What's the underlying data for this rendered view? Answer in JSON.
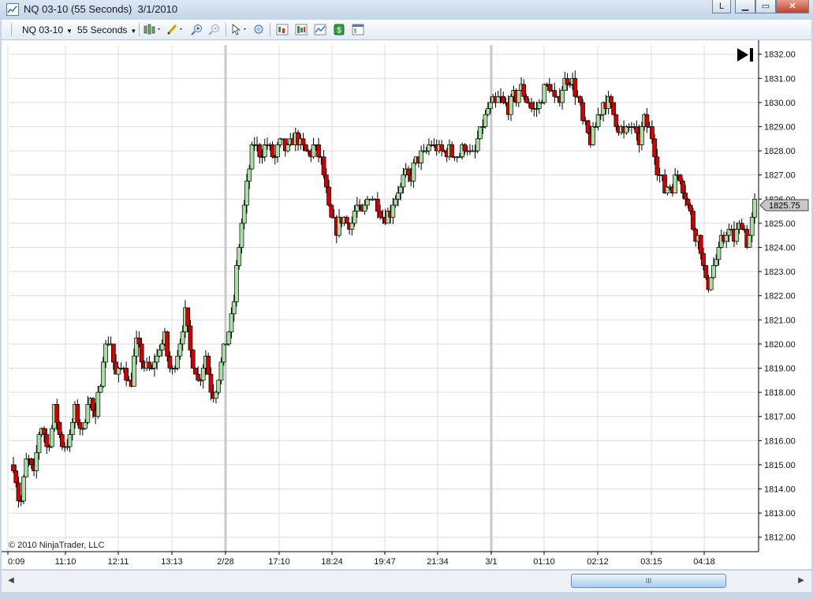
{
  "window": {
    "title": "NQ 03-10 (55 Seconds)  3/1/2010",
    "link_button": "L",
    "minimize_label": "▁",
    "maximize_label": "▭",
    "close_label": "✕"
  },
  "toolbar": {
    "instrument": "NQ 03-10",
    "interval": "55 Seconds",
    "icons": [
      "bar-style-icon",
      "drawing-tool-icon",
      "zoom-in-icon",
      "zoom-out-icon",
      "pointer-icon",
      "magnifier-icon",
      "data-series-icon",
      "strategies-icon",
      "indicators-icon",
      "order-entry-icon",
      "properties-icon"
    ]
  },
  "colors": {
    "up_candle": "#a8e0a4",
    "down_candle": "#d40000",
    "wick": "#000000",
    "grid": "#dcdcdc",
    "session_break": "#c8c8c8"
  },
  "copyright": "© 2010 NinjaTrader, LLC",
  "scroll": {
    "thumb_label": "III"
  },
  "chart_data": {
    "type": "candlestick",
    "symbol": "NQ 03-10",
    "interval": "55 Seconds",
    "ylim": [
      1812,
      1832.5
    ],
    "yticks": [
      "1812.00",
      "1813.00",
      "1814.00",
      "1815.00",
      "1816.00",
      "1817.00",
      "1818.00",
      "1819.00",
      "1820.00",
      "1821.00",
      "1822.00",
      "1823.00",
      "1824.00",
      "1825.00",
      "1826.00",
      "1827.00",
      "1828.00",
      "1829.00",
      "1830.00",
      "1831.00",
      "1832.00"
    ],
    "xticks": [
      "0:09",
      "11:10",
      "12:11",
      "13:13",
      "2/28",
      "17:10",
      "18:24",
      "19:47",
      "21:34",
      "3/1",
      "01:10",
      "02:12",
      "03:15",
      "04:18"
    ],
    "session_breaks": [
      "2/28",
      "3/1"
    ],
    "last_price": "1825.75",
    "path": [
      1815,
      1813.2,
      1815.4,
      1814.6,
      1816.8,
      1815.5,
      1817.2,
      1816.0,
      1815.8,
      1817.4,
      1816.2,
      1818.0,
      1816.8,
      1819.4,
      1820.3,
      1818.6,
      1819.2,
      1818.2,
      1820.1,
      1819.0,
      1818.8,
      1819.6,
      1820.3,
      1818.6,
      1819.8,
      1821.2,
      1819.4,
      1818.4,
      1819.6,
      1817.8,
      1818.8,
      1820.2,
      1821.4,
      1824.5,
      1826.5,
      1828.5,
      1827.8,
      1828.2,
      1827.6,
      1828.3,
      1828.0,
      1828.6,
      1828.1,
      1827.8,
      1828.2,
      1827.4,
      1825.4,
      1824.8,
      1825.3,
      1824.9,
      1825.6,
      1825.4,
      1826.2,
      1825.9,
      1825.1,
      1825.6,
      1826.3,
      1826.8,
      1827.1,
      1827.6,
      1827.9,
      1828.3,
      1828.0,
      1828.1,
      1827.9,
      1827.8,
      1828.2,
      1827.7,
      1828.7,
      1829.7,
      1829.9,
      1830.1,
      1829.8,
      1830.2,
      1830.6,
      1830.1,
      1829.5,
      1830.3,
      1830.8,
      1829.9,
      1830.6,
      1831.1,
      1830.4,
      1829.2,
      1828.4,
      1829.2,
      1830.1,
      1829.9,
      1829.2,
      1828.6,
      1829.1,
      1828.2,
      1829.3,
      1828.6,
      1827.1,
      1826.4,
      1826.6,
      1827.2,
      1826.1,
      1824.9,
      1824.3,
      1822.3,
      1823.3,
      1824.0,
      1824.8,
      1824.4,
      1825.1,
      1824.2,
      1825.75
    ]
  }
}
